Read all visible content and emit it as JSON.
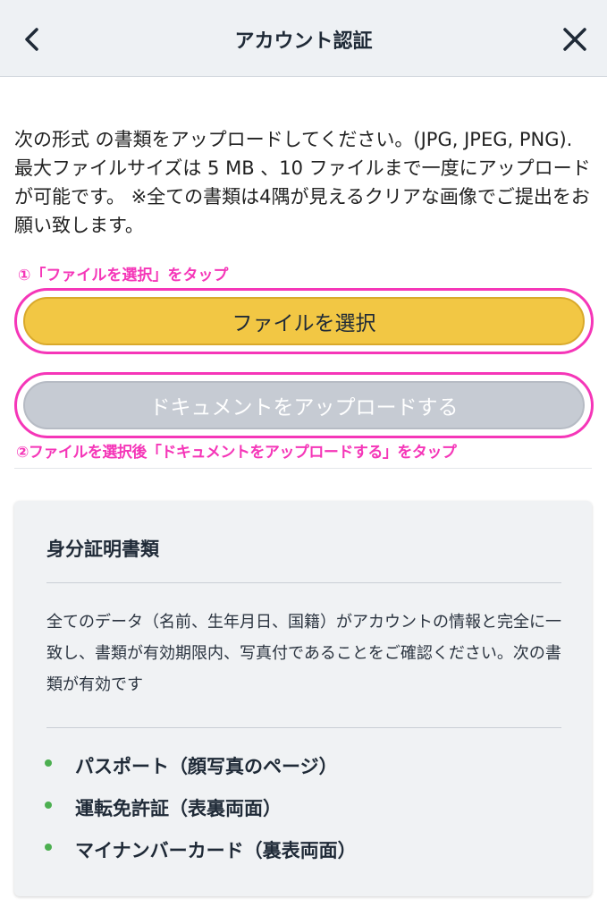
{
  "header": {
    "title": "アカウント認証",
    "back_icon": "chevron-left-icon",
    "close_icon": "close-icon"
  },
  "intro": {
    "line1": "次の形式 の書類をアップロードしてください。(JPG, JPEG, PNG).",
    "line2": "最大ファイルサイズは 5 MB 、10 ファイルまで一度にアップロードが可能です。 ※全ての書類は4隅が見えるクリアな画像でご提出をお願い致します。"
  },
  "annotations": {
    "step1": "①「ファイルを選択」をタップ",
    "step2": "②ファイルを選択後「ドキュメントをアップロードする」をタップ",
    "highlight_color": "#f536b8"
  },
  "buttons": {
    "select_file": "ファイルを選択",
    "upload_document": "ドキュメントをアップロードする"
  },
  "card": {
    "title": "身分証明書類",
    "description": "全てのデータ（名前、生年月日、国籍）がアカウントの情報と完全に一致し、書類が有効期限内、写真付であることをご確認ください。次の書類が有効です",
    "documents": [
      "パスポート（顔写真のページ）",
      "運転免許証（表裏両面）",
      "マイナンバーカード（裏表両面）"
    ]
  },
  "colors": {
    "accent_button": "#f2c744",
    "disabled_button": "#c6cbd3",
    "bullet": "#4caf50"
  }
}
